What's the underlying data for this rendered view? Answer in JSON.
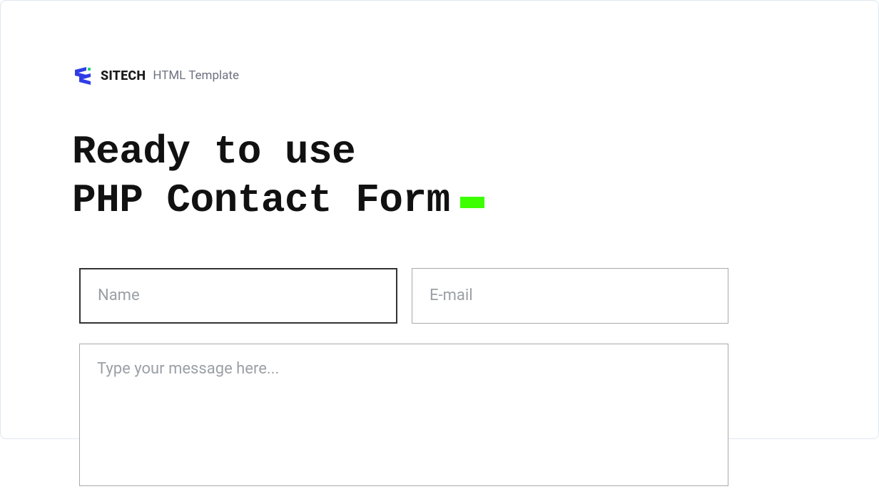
{
  "brand": {
    "name": "SITECH",
    "subtitle": "HTML Template"
  },
  "headline": {
    "line1": "Ready to use",
    "line2": "PHP Contact Form"
  },
  "form": {
    "name_placeholder": "Name",
    "email_placeholder": "E-mail",
    "message_placeholder": "Type your message here...",
    "name_value": "",
    "email_value": "",
    "message_value": ""
  },
  "colors": {
    "accent_cursor": "#3cff00",
    "brand_blue": "#2f3de6"
  }
}
